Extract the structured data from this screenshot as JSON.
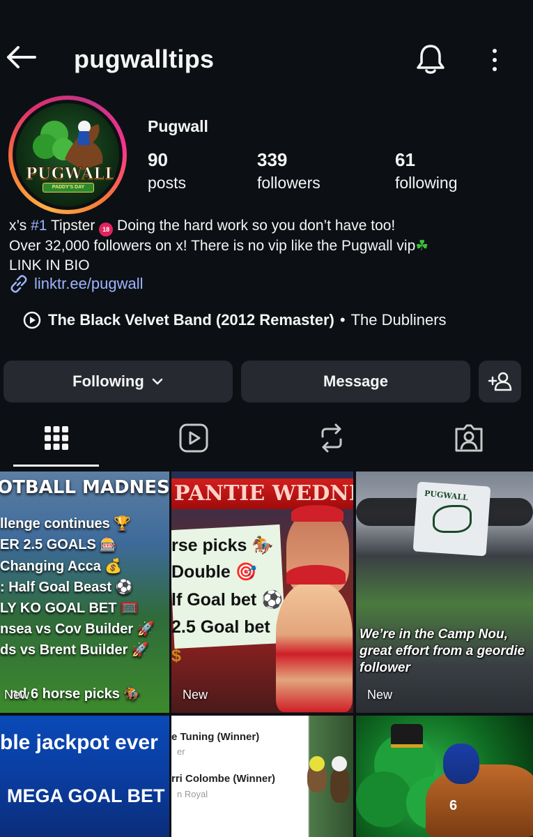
{
  "header": {
    "username": "pugwalltips"
  },
  "profile": {
    "display_name": "Pugwall",
    "avatar": {
      "logo_text": "PUGWALL",
      "ribbon_text": "PADDY'S DAY"
    },
    "stats": [
      {
        "count": "90",
        "label": "posts"
      },
      {
        "count": "339",
        "label": "followers"
      },
      {
        "count": "61",
        "label": "following"
      }
    ],
    "bio": {
      "line1_pre": "x’s ",
      "line1_hash": "#1",
      "line1_mid": " Tipster ",
      "line1_badge": "18",
      "line1_post": " Doing the hard work so you don’t have too!",
      "line2": "Over 32,000 followers on x! There is no vip like the Pugwall vip",
      "line3": "LINK IN BIO"
    },
    "link": "linktr.ee/pugwall",
    "music": {
      "title": "The Black Velvet Band (2012 Remaster)",
      "separator": "•",
      "artist": "The Dubliners"
    }
  },
  "actions": {
    "following_label": "Following",
    "message_label": "Message"
  },
  "tabs": [
    "grid-icon",
    "reels-icon",
    "reposts-icon",
    "tagged-icon"
  ],
  "posts": [
    {
      "heading": "OTBALL MADNES",
      "lines": [
        "llenge continues 🏆",
        "ER 2.5 GOALS 🎰",
        "Changing Acca 💰",
        ": Half Goal Beast ⚽",
        "LY KO GOAL BET 🥅",
        "nsea vs Cov Builder 🚀",
        "ds vs Brent Builder 🚀",
        "nd 6 horse picks 🏇"
      ],
      "badge": "New"
    },
    {
      "heading": "PANTIE WEDNE",
      "lines": [
        "rse picks 🏇",
        "Double 🎯",
        "lf Goal bet ⚽",
        "2.5 Goal bet ⚽",
        "$"
      ],
      "badge": "New"
    },
    {
      "post_text": "PUGWALL",
      "caption": "We’re in the Camp Nou, great effort from a geordie follower",
      "badge": "New"
    },
    {
      "heading": "ble jackpot ever",
      "line": "MEGA GOAL BET"
    },
    {
      "lines": [
        "e Tuning (Winner)",
        "er",
        "rri Colombe (Winner)",
        "n Royal"
      ]
    },
    {
      "badge_num": "6"
    }
  ],
  "colors": {
    "background": "#0c1014",
    "button_bg": "#262a30",
    "link": "#9db4ff",
    "text": "#f5f5f5"
  }
}
